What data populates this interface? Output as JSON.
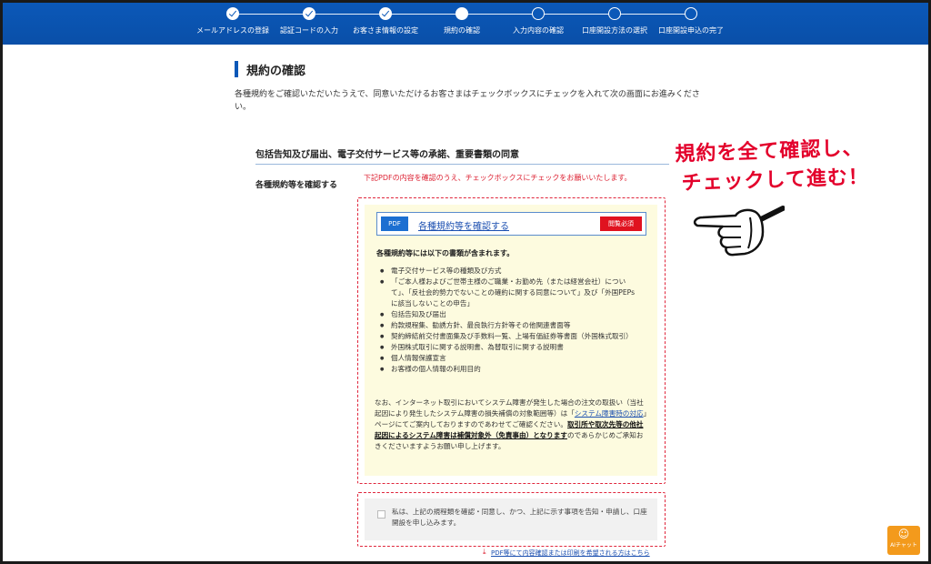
{
  "header": {
    "steps": [
      {
        "label": "メールアドレスの登録",
        "state": "done"
      },
      {
        "label": "認証コードの入力",
        "state": "done"
      },
      {
        "label": "お客さま情報の設定",
        "state": "done"
      },
      {
        "label": "規約の確認",
        "state": "current"
      },
      {
        "label": "入力内容の確認",
        "state": "todo"
      },
      {
        "label": "口座開設方法の選択",
        "state": "todo"
      },
      {
        "label": "口座開設申込の完了",
        "state": "todo"
      }
    ]
  },
  "main": {
    "title": "規約の確認",
    "intro": "各種規約をご確認いただいたうえで、同意いただけるお客さまはチェックボックスにチェックを入れて次の画面にお進みください。",
    "section_title": "包括告知及び届出、電子交付サービス等の承諾、重要書類の同意",
    "row_label": "各種規約等を確認する",
    "notice": "下記PDFの内容を確認のうえ、チェックボックスにチェックをお願いいたします。",
    "pdf": {
      "tag": "PDF",
      "link": "各種規約等を確認する",
      "required": "閲覧必須"
    },
    "docs_head": "各種規約等には以下の書類が含まれます。",
    "docs": [
      "電子交付サービス等の種類及び方式",
      "「ご本人様およびご世帯主様のご職業・お勤め先（または経営会社）について」、「反社会的勢力でないことの確約に関する同意について」及び「外国PEPsに該当しないことの申告」",
      "包括告知及び届出",
      "約款規程集、勧誘方針、最良執行方針等その他関連書面等",
      "契約締結前交付書面集及び手数料一覧、上場有価証券等書面（外国株式取引）",
      "外国株式取引に関する説明書、為替取引に関する説明書",
      "個人情報保護宣言",
      "お客様の個人情報の利用目的"
    ],
    "note_a": "なお、インターネット取引においてシステム障害が発生した場合の注文の取扱い（当社起因により発生したシステム障害の損失補償の対象範囲等）は「",
    "note_link": "システム障害時の対応",
    "note_b": "」ページにてご案内しておりますのであわせてご確認ください。",
    "note_bold": "取引所や取次先等の他社起因によるシステム障害は補償対象外（免責事由）となります",
    "note_c": "のであらかじめご承知おきくださいますようお願い申し上げます。",
    "agree_text": "私は、上記の規程類を確認・同意し、かつ、上記に示す事項を告知・申請し、口座開設を申し込みます。",
    "print_link": "PDF等にて内容確認または印刷を希望される方はこちら"
  },
  "annotation": {
    "line1": "規約を全て確認し、",
    "line2": "チェックして進む！"
  },
  "aichat": {
    "label": "AIチャット"
  },
  "colors": {
    "header": "#0b58b8",
    "accent": "#e0263c",
    "yellow": "#fdfbdf",
    "aichat": "#f39a1c"
  }
}
